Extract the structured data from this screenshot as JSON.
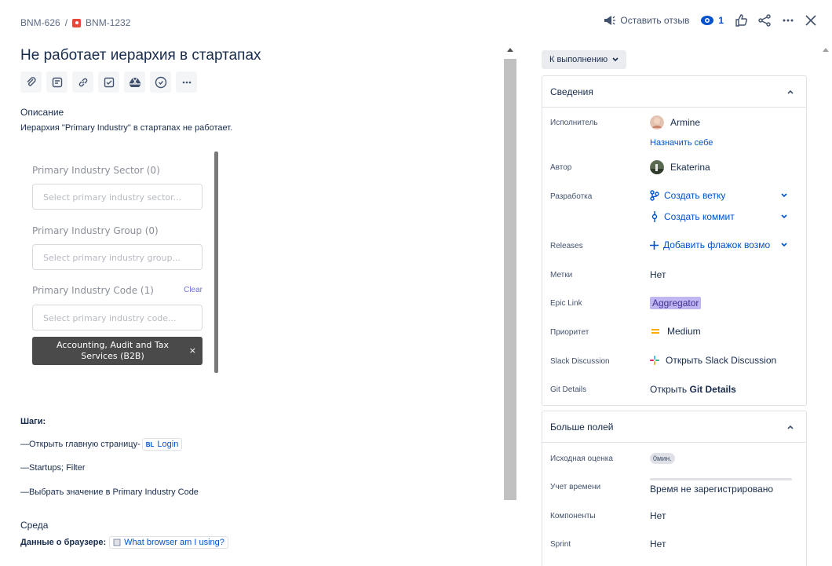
{
  "breadcrumb": {
    "parent": "BNM-626",
    "separator": "/",
    "issue": "BNM-1232"
  },
  "top_actions": {
    "feedback": "Оставить отзыв",
    "watch_count": "1"
  },
  "issue": {
    "title": "Не работает иерархия в стартапах",
    "description_label": "Описание",
    "description_text": "Иерархия \"Primary Industry\" в стартапах не работает."
  },
  "toolbar_icons": [
    "paperclip-icon",
    "subtask-icon",
    "link-icon",
    "checkbox-icon",
    "google-drive-icon",
    "clock-icon",
    "more-icon"
  ],
  "embed": {
    "sector_label": "Primary Industry Sector (0)",
    "sector_placeholder": "Select primary industry sector...",
    "group_label": "Primary Industry Group (0)",
    "group_placeholder": "Select primary industry group...",
    "code_label": "Primary Industry Code (1)",
    "clear": "Clear",
    "code_placeholder": "Select primary industry code...",
    "chip": "Accounting, Audit and Tax Services (B2B)",
    "chip_close": "×"
  },
  "steps": {
    "heading": "Шаги:",
    "step1": "—Открыть главную страницу-",
    "step1_badge": "BL",
    "step1_link": "Login",
    "step2": "—Startups; Filter",
    "step3": "—Выбрать значение в Primary Industry Code"
  },
  "environment": {
    "label": "Среда",
    "browser_label": "Данные о браузере:",
    "browser_link": "What browser am I using?"
  },
  "status": {
    "label": "К выполнению"
  },
  "details": {
    "header": "Сведения",
    "assignee_label": "Исполнитель",
    "assignee": "Armine",
    "assign_self": "Назначить себе",
    "reporter_label": "Автор",
    "reporter": "Ekaterina",
    "dev_label": "Разработка",
    "create_branch": "Создать ветку",
    "create_commit": "Создать коммит",
    "releases_label": "Releases",
    "add_flag": "Добавить флажок возмо",
    "labels_label": "Метки",
    "labels_value": "Нет",
    "epic_label": "Epic Link",
    "epic_value": "Aggregator",
    "priority_label": "Приоритет",
    "priority_value": "Medium",
    "slack_label": "Slack Discussion",
    "slack_open": "Открыть",
    "slack_value": "Slack Discussion",
    "git_label": "Git Details",
    "git_open": "Открыть",
    "git_value": "Git Details"
  },
  "more_fields": {
    "header": "Больше полей",
    "estimate_label": "Исходная оценка",
    "estimate_value": "0мин.",
    "time_label": "Учет времени",
    "time_value": "Время не зарегистрировано",
    "components_label": "Компоненты",
    "components_value": "Нет",
    "sprint_label": "Sprint",
    "sprint_value": "Нет"
  },
  "colors": {
    "accent": "#0052cc",
    "bug": "#e5493a",
    "epic_bg": "#c0b6f2",
    "priority": "#ffab00"
  }
}
